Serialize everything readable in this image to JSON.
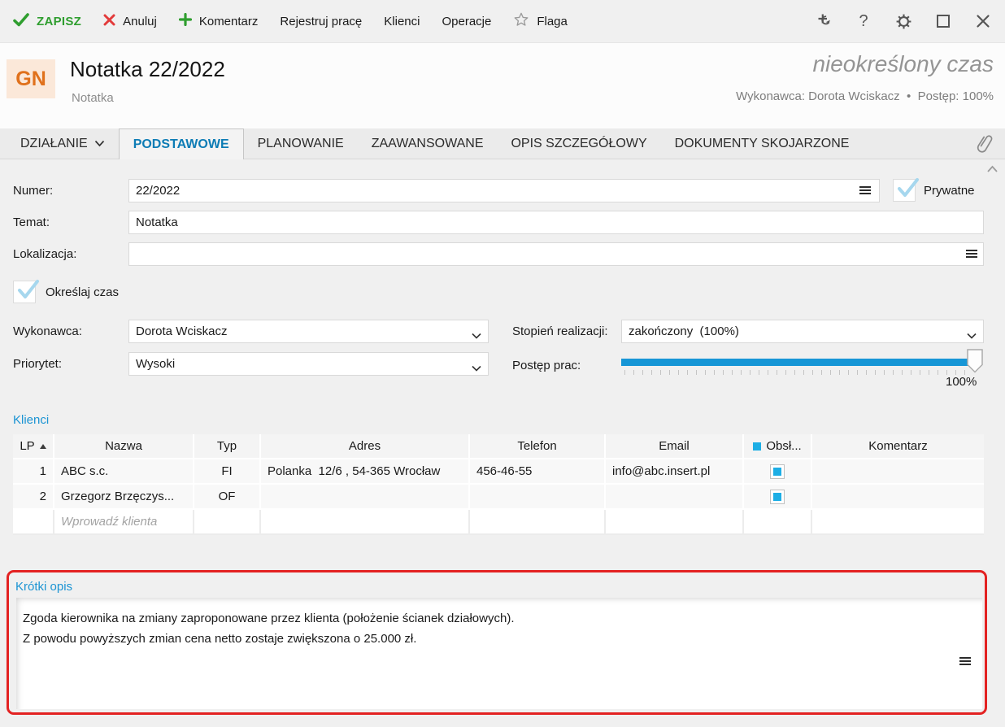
{
  "toolbar": {
    "save": "ZAPISZ",
    "cancel": "Anuluj",
    "comment": "Komentarz",
    "register_work": "Rejestruj pracę",
    "clients": "Klienci",
    "operations": "Operacje",
    "flag": "Flaga",
    "help": "?"
  },
  "header": {
    "badge": "GN",
    "title": "Notatka 22/2022",
    "subtitle": "Notatka",
    "time_info": "nieokreślony czas",
    "meta": "Wykonawca: Dorota Wciskacz  •  Postęp: 100%"
  },
  "tabs": {
    "action": "DZIAŁANIE",
    "active": "PODSTAWOWE",
    "items": [
      "PODSTAWOWE",
      "PLANOWANIE",
      "ZAAWANSOWANE",
      "OPIS SZCZEGÓŁOWY",
      "DOKUMENTY SKOJARZONE"
    ]
  },
  "form": {
    "numer": {
      "label": "Numer:",
      "value": "22/2022"
    },
    "prywatne": {
      "label": "Prywatne",
      "checked": true
    },
    "temat": {
      "label": "Temat:",
      "value": "Notatka"
    },
    "lokalizacja": {
      "label": "Lokalizacja:",
      "value": ""
    },
    "okreslaj_czas": {
      "label": "Określaj czas",
      "checked": true
    },
    "wykonawca": {
      "label": "Wykonawca:",
      "value": "Dorota Wciskacz"
    },
    "stopien_realizacji": {
      "label": "Stopień realizacji:",
      "value": "zakończony  (100%)"
    },
    "priorytet": {
      "label": "Priorytet:",
      "value": "Wysoki"
    },
    "postep_prac": {
      "label": "Postęp prac:",
      "value": "100%",
      "percent": 100
    }
  },
  "clients": {
    "section_label": "Klienci",
    "headers": {
      "lp": "LP",
      "nazwa": "Nazwa",
      "typ": "Typ",
      "adres": "Adres",
      "telefon": "Telefon",
      "email": "Email",
      "obsl": "Obsł...",
      "komentarz": "Komentarz"
    },
    "rows": [
      {
        "lp": "1",
        "nazwa": "ABC s.c.",
        "typ": "FI",
        "adres": "Polanka  12/6 , 54-365 Wrocław",
        "telefon": "456-46-55",
        "email": "info@abc.insert.pl",
        "obsl_checked": true,
        "komentarz": ""
      },
      {
        "lp": "2",
        "nazwa": "Grzegorz Brzęczys...",
        "typ": "OF",
        "adres": "",
        "telefon": "",
        "email": "",
        "obsl_checked": true,
        "komentarz": ""
      },
      {
        "lp": "",
        "nazwa": "Wprowadź klienta",
        "typ": "",
        "adres": "",
        "telefon": "",
        "email": "",
        "obsl_checked": false,
        "komentarz": ""
      }
    ]
  },
  "short_description": {
    "section_label": "Krótki opis",
    "lines": [
      "Zgoda kierownika na zmiany zaproponowane przez klienta (położenie ścianek działowych).",
      "Z powodu powyższych zmian cena netto zostaje zwiększona o 25.000 zł."
    ]
  },
  "icons": {
    "save": "check",
    "cancel": "x-mark",
    "comment": "plus",
    "flag": "star-outline",
    "pin": "plus-rotate-arrow",
    "help": "question-mark",
    "settings": "gear",
    "maximize": "square",
    "close": "x-mark",
    "attachments": "paperclip",
    "field_menu": "hamburger",
    "dropdown": "chevron-down",
    "sort": "triangle-up",
    "obsl_header": "blue-square",
    "collapse": "chevron-up"
  },
  "colors": {
    "accent_blue": "#1b94d3",
    "active_tab_blue": "#0d7cb5",
    "toolbar_green": "#2f9e2f",
    "toolbar_red": "#e23b3b",
    "badge_orange": "#e0711c",
    "badge_bg": "#fbe8d9",
    "slider_blue": "#1796d6",
    "checkbox_blue": "#1daee5",
    "light_check_blue": "#a6d7ee",
    "highlight_red": "#e32222"
  }
}
